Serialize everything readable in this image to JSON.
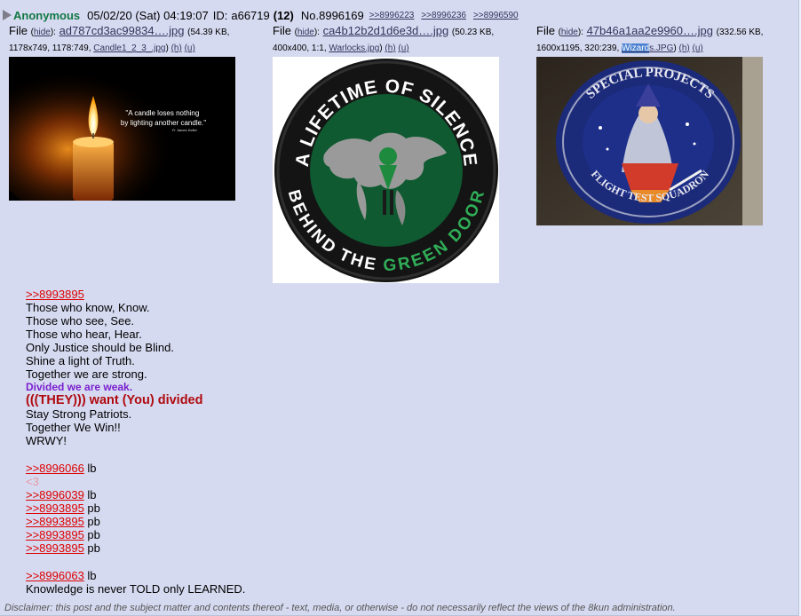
{
  "header": {
    "name": "Anonymous",
    "date": "05/02/20 (Sat) 04:19:07",
    "id_label": "ID:",
    "id_value": "a66719",
    "id_count": "(12)",
    "post_number": "No.8996169",
    "backlinks": [
      ">>8996223",
      ">>8996236",
      ">>8996590"
    ]
  },
  "files": [
    {
      "label": "File",
      "hide": "hide",
      "name": "ad787cd3ac99834….jpg",
      "size": "54.39 KB,",
      "dims": "1178x749, 1178:749,",
      "orig_name": "Candle1_2_3_.jpg",
      "h": "(h)",
      "u": "(u)",
      "caption": "\"A candle loses nothing by lighting another candle.\"",
      "caption_author": "Fr James Keller"
    },
    {
      "label": "File",
      "hide": "hide",
      "name": "ca4b12b2d1d6e3d….jpg",
      "size": "50.23 KB,",
      "dims": "400x400, 1:1,",
      "orig_name": "Warlocks.jpg",
      "h": "(h)",
      "u": "(u)"
    },
    {
      "label": "File",
      "hide": "hide",
      "name": "47b46a1aa2e9960….jpg",
      "size": "332.56 KB,",
      "dims": "1600x1195, 320:239,",
      "orig_name_highlight": "Wizard",
      "orig_name_rest": "s.JPG",
      "h": "(h)",
      "u": "(u)"
    }
  ],
  "patch_texts": {
    "silence_top": "A LIFETIME OF SILENCE",
    "silence_bottom_a": "BEHIND THE ",
    "silence_bottom_b": "GREEN DOOR",
    "wizard_top": "SPECIAL PROJECTS",
    "wizard_bottom": "FLIGHT TEST SQUADRON"
  },
  "body": {
    "ref1": ">>8993895",
    "lines": [
      "Those who know, Know.",
      "Those who see, See.",
      "Those who hear, Hear.",
      "Only Justice should be Blind.",
      "Shine a light of Truth.",
      "Together we are strong."
    ],
    "purple": "Divided we are weak.",
    "red": "(((THEY))) want (You) divided",
    "lines2": [
      "Stay Strong Patriots.",
      "Together We Win!!",
      "WRWY!"
    ],
    "refs": [
      {
        "ref": ">>8996066",
        "note": " lb"
      },
      {
        "ref": ">>8996039",
        "note": " lb"
      },
      {
        "ref": ">>8993895",
        "note": " pb"
      },
      {
        "ref": ">>8993895",
        "note": " pb"
      },
      {
        "ref": ">>8993895",
        "note": " pb"
      },
      {
        "ref": ">>8993895",
        "note": " pb"
      }
    ],
    "heart": "<3",
    "last_ref": ">>8996063",
    "last_note": " lb",
    "final_line": "Knowledge is never TOLD only LEARNED."
  },
  "disclaimer": "Disclaimer: this post and the subject matter and contents thereof - text, media, or otherwise - do not necessarily reflect the views of the 8kun administration.",
  "colors": {
    "post_bg": "#d6daf0",
    "name": "#117743",
    "link": "#34345c",
    "reply_ref": "#dd0000",
    "purple_text": "#7a1fcf",
    "red_text": "#af0a0f",
    "heart": "#e69aa6"
  }
}
